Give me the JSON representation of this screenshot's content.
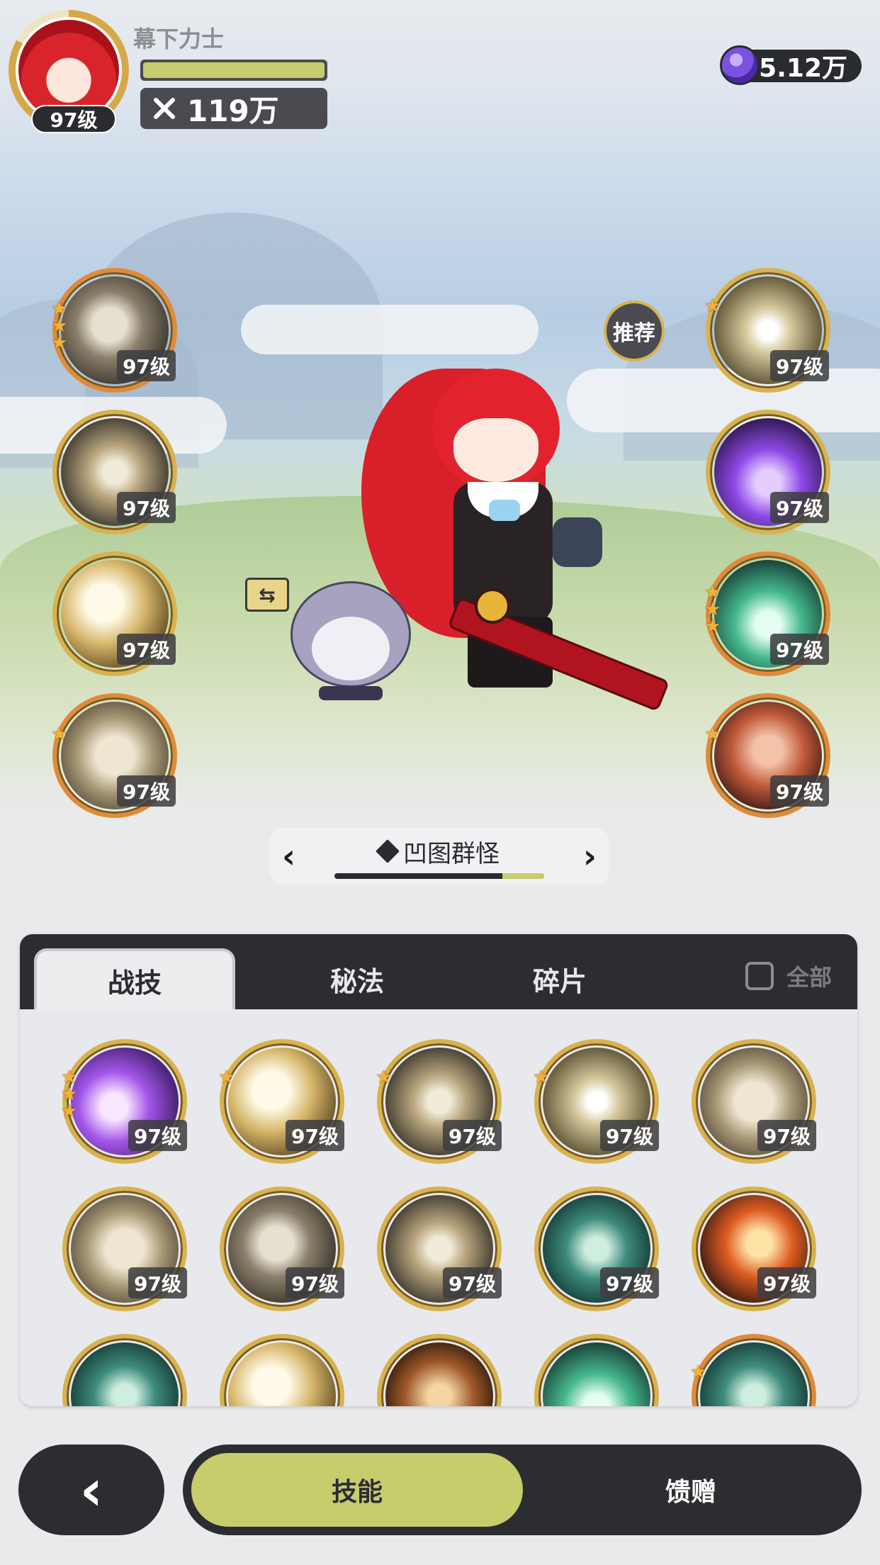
{
  "player": {
    "name": "幕下力士",
    "level": "97级",
    "power": "119万",
    "exp_fraction": 1.0
  },
  "currency": {
    "amount": "5.12万",
    "icon": "purple-gem-icon"
  },
  "recommend_label": "推荐",
  "left_skills": [
    {
      "level": "97级",
      "stars": 3,
      "ring": "orange",
      "icon": "shadow-hand-icon"
    },
    {
      "level": "97级",
      "stars": 0,
      "ring": "gold",
      "icon": "swirl-slash-icon"
    },
    {
      "level": "97级",
      "stars": 0,
      "ring": "gold",
      "icon": "golden-slash-icon"
    },
    {
      "level": "97级",
      "stars": 1,
      "ring": "orange",
      "icon": "whirlwind-icon"
    }
  ],
  "right_skills": [
    {
      "level": "97级",
      "stars": 1,
      "ring": "gold",
      "icon": "all-seeing-eye-icon"
    },
    {
      "level": "97级",
      "stars": 0,
      "ring": "gold",
      "icon": "purple-flame-icon"
    },
    {
      "level": "97级",
      "stars": 3,
      "ring": "orange",
      "icon": "green-heal-icon"
    },
    {
      "level": "97级",
      "stars": 1,
      "ring": "orange",
      "icon": "crimson-armor-icon"
    }
  ],
  "preset": {
    "name": "凹图群怪",
    "progress": 0.8
  },
  "tabs": {
    "combat": "战技",
    "secret": "秘法",
    "fragments": "碎片",
    "all": "全部"
  },
  "grid_skills": [
    {
      "level": "97级",
      "stars": 3,
      "icon": "violet-comet-icon"
    },
    {
      "level": "97级",
      "stars": 1,
      "icon": "sword-strike-icon"
    },
    {
      "level": "97级",
      "stars": 1,
      "icon": "spike-burst-icon"
    },
    {
      "level": "97级",
      "stars": 1,
      "icon": "radiant-burst-icon"
    },
    {
      "level": "97级",
      "stars": 0,
      "icon": "crescent-slash-icon"
    },
    {
      "level": "97级",
      "stars": 0,
      "icon": "gale-icon"
    },
    {
      "level": "97级",
      "stars": 0,
      "icon": "shatter-icon"
    },
    {
      "level": "97级",
      "stars": 0,
      "icon": "lightning-slash-icon"
    },
    {
      "level": "97级",
      "stars": 0,
      "icon": "web-icon"
    },
    {
      "level": "97级",
      "stars": 0,
      "icon": "fire-arc-icon"
    }
  ],
  "bottom_nav": {
    "skills": "技能",
    "gift": "馈赠"
  }
}
